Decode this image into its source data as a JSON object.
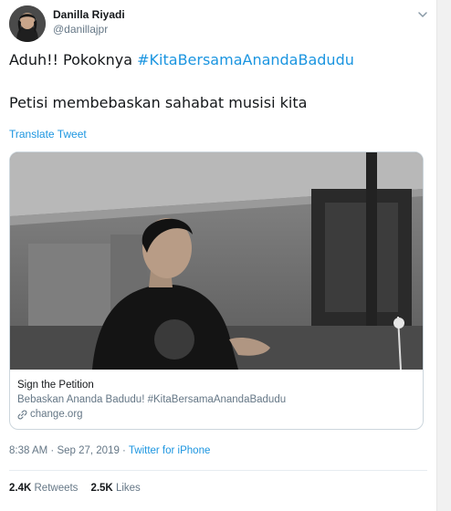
{
  "author": {
    "display_name": "Danilla Riyadi",
    "handle": "@danillajpr"
  },
  "tweet": {
    "line1_prefix": "Aduh!! Pokoknya ",
    "line1_hashtag": "#KitaBersamaAnandaBadudu",
    "line2": "Petisi membebaskan sahabat musisi kita",
    "translate_label": "Translate Tweet"
  },
  "card": {
    "title": "Sign the Petition",
    "description": "Bebaskan Ananda Badudu! #KitaBersamaAnandaBadudu",
    "domain": "change.org"
  },
  "meta": {
    "time": "8:38 AM",
    "separator1": " · ",
    "date": "Sep 27, 2019",
    "separator2": " · ",
    "source": "Twitter for iPhone"
  },
  "stats": {
    "retweets_count": "2.4K",
    "retweets_label": "Retweets",
    "likes_count": "2.5K",
    "likes_label": "Likes"
  },
  "icons": {
    "caret": "chevron-down-icon",
    "link": "link-icon"
  },
  "colors": {
    "link_blue": "#1b95e0",
    "text": "#14171a",
    "muted": "#657786",
    "border": "#ccd6dd"
  }
}
